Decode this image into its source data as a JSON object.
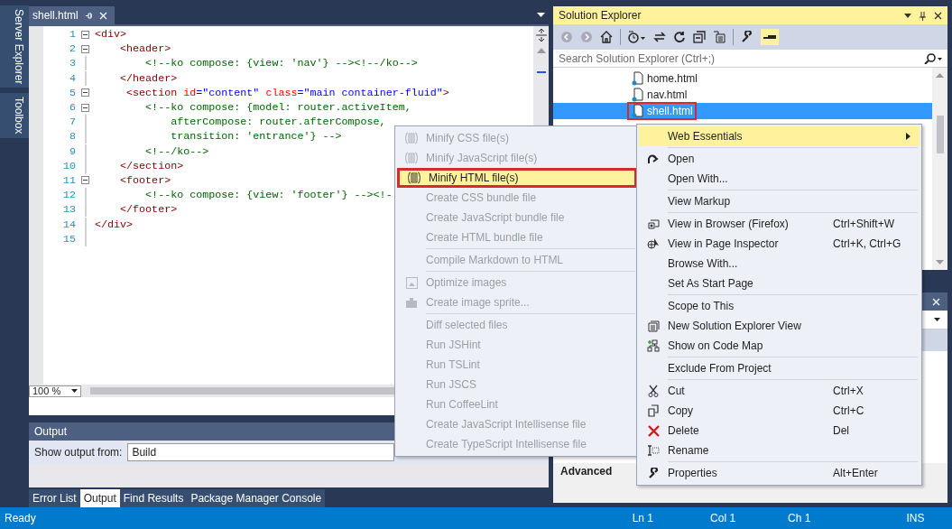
{
  "side_tabs": [
    "Server Explorer",
    "Toolbox"
  ],
  "editor": {
    "tab": {
      "label": "shell.html",
      "selected": true
    },
    "lines": [
      {
        "number": "1",
        "fold": true,
        "parts": [
          {
            "kind": "tag",
            "text": "<div>"
          }
        ]
      },
      {
        "number": "2",
        "fold": true,
        "parts": [
          {
            "kind": "tag",
            "text": "    <header>"
          }
        ]
      },
      {
        "number": "3",
        "fold": false,
        "parts": [
          {
            "kind": "comment",
            "text": "        <!--ko compose: {view: 'nav'} --><!--/ko-->"
          }
        ]
      },
      {
        "number": "4",
        "fold": false,
        "parts": [
          {
            "kind": "tag",
            "text": "    </header>"
          }
        ]
      },
      {
        "number": "5",
        "fold": true,
        "parts": [
          {
            "kind": "tag",
            "text": "     <section"
          },
          {
            "kind": "attr",
            "text": " id"
          },
          {
            "kind": "value",
            "text": "=\"content\""
          },
          {
            "kind": "attr",
            "text": " class"
          },
          {
            "kind": "value",
            "text": "=\"main container-fluid\""
          },
          {
            "kind": "tag",
            "text": ">"
          }
        ]
      },
      {
        "number": "6",
        "fold": true,
        "parts": [
          {
            "kind": "comment",
            "text": "        <!--ko compose: {model: router.activeItem,"
          }
        ]
      },
      {
        "number": "7",
        "fold": false,
        "parts": [
          {
            "kind": "comment",
            "text": "            afterCompose: router.afterCompose,"
          }
        ]
      },
      {
        "number": "8",
        "fold": false,
        "parts": [
          {
            "kind": "comment",
            "text": "            transition: 'entrance'} -->"
          }
        ]
      },
      {
        "number": "9",
        "fold": false,
        "parts": [
          {
            "kind": "comment",
            "text": "        <!--/ko-->"
          }
        ]
      },
      {
        "number": "10",
        "fold": false,
        "parts": [
          {
            "kind": "tag",
            "text": "    </section>"
          }
        ]
      },
      {
        "number": "11",
        "fold": true,
        "parts": [
          {
            "kind": "tag",
            "text": "    <footer>"
          }
        ]
      },
      {
        "number": "12",
        "fold": false,
        "parts": [
          {
            "kind": "comment",
            "text": "        <!--ko compose: {view: 'footer'} --><!-"
          }
        ]
      },
      {
        "number": "13",
        "fold": false,
        "parts": [
          {
            "kind": "tag",
            "text": "    </footer>"
          }
        ]
      },
      {
        "number": "14",
        "fold": false,
        "parts": [
          {
            "kind": "tag",
            "text": "</div>"
          }
        ]
      },
      {
        "number": "15",
        "fold": false
      }
    ],
    "zoom": "100 %"
  },
  "output": {
    "title": "Output",
    "show_from_label": "Show output from:",
    "source": "Build"
  },
  "bottom_tabs": [
    {
      "label": "Error List",
      "selected": false
    },
    {
      "label": "Output",
      "selected": true
    },
    {
      "label": "Find Results",
      "selected": false
    },
    {
      "label": "Package Manager Console",
      "selected": false
    }
  ],
  "solution_explorer": {
    "title": "Solution Explorer",
    "search": {
      "placeholder": "Search Solution Explorer (Ctrl+;)"
    },
    "items": [
      {
        "label": "home.html",
        "selected": false,
        "outlined": false
      },
      {
        "label": "nav.html",
        "selected": false,
        "outlined": false
      },
      {
        "label": "shell.html",
        "selected": true,
        "outlined": true
      }
    ]
  },
  "properties": {
    "section": "Advanced"
  },
  "context_menu": [
    {
      "kind": "item",
      "label": "Web Essentials",
      "highlighted": true,
      "submenu": true
    },
    {
      "kind": "separator"
    },
    {
      "kind": "item",
      "label": "Open",
      "highlighted": false
    },
    {
      "kind": "item",
      "label": "Open With...",
      "highlighted": false
    },
    {
      "kind": "separator"
    },
    {
      "kind": "item",
      "label": "View Markup",
      "highlighted": false
    },
    {
      "kind": "separator"
    },
    {
      "kind": "item",
      "label": "View in Browser (Firefox)",
      "shortcut": "Ctrl+Shift+W",
      "highlighted": false
    },
    {
      "kind": "item",
      "label": "View in Page Inspector",
      "shortcut": "Ctrl+K, Ctrl+G",
      "highlighted": false
    },
    {
      "kind": "item",
      "label": "Browse With...",
      "highlighted": false
    },
    {
      "kind": "item",
      "label": "Set As Start Page",
      "highlighted": false
    },
    {
      "kind": "separator"
    },
    {
      "kind": "item",
      "label": "Scope to This",
      "highlighted": false
    },
    {
      "kind": "item",
      "label": "New Solution Explorer View",
      "highlighted": false
    },
    {
      "kind": "item",
      "label": "Show on Code Map",
      "highlighted": false
    },
    {
      "kind": "separator"
    },
    {
      "kind": "item",
      "label": "Exclude From Project",
      "highlighted": false
    },
    {
      "kind": "separator"
    },
    {
      "kind": "item",
      "label": "Cut",
      "shortcut": "Ctrl+X",
      "highlighted": false
    },
    {
      "kind": "item",
      "label": "Copy",
      "shortcut": "Ctrl+C",
      "highlighted": false
    },
    {
      "kind": "item",
      "label": "Delete",
      "shortcut": "Del",
      "highlighted": false
    },
    {
      "kind": "item",
      "label": "Rename",
      "highlighted": false
    },
    {
      "kind": "separator"
    },
    {
      "kind": "item",
      "label": "Properties",
      "shortcut": "Alt+Enter",
      "highlighted": false
    }
  ],
  "submenu": [
    {
      "kind": "item",
      "label": "Minify CSS file(s)",
      "disabled": true,
      "highlighted": false,
      "outlined": false
    },
    {
      "kind": "item",
      "label": "Minify JavaScript file(s)",
      "disabled": true,
      "highlighted": false,
      "outlined": false
    },
    {
      "kind": "item",
      "label": "Minify HTML file(s)",
      "disabled": false,
      "highlighted": true,
      "outlined": true
    },
    {
      "kind": "item",
      "label": "Create CSS bundle file",
      "disabled": true,
      "highlighted": false,
      "outlined": false
    },
    {
      "kind": "item",
      "label": "Create JavaScript bundle file",
      "disabled": true,
      "highlighted": false,
      "outlined": false
    },
    {
      "kind": "item",
      "label": "Create HTML bundle file",
      "disabled": true,
      "highlighted": false,
      "outlined": false
    },
    {
      "kind": "separator"
    },
    {
      "kind": "item",
      "label": "Compile Markdown to HTML",
      "disabled": true,
      "highlighted": false,
      "outlined": false
    },
    {
      "kind": "separator"
    },
    {
      "kind": "item",
      "label": "Optimize images",
      "disabled": true,
      "highlighted": false,
      "outlined": false
    },
    {
      "kind": "item",
      "label": "Create image sprite...",
      "disabled": true,
      "highlighted": false,
      "outlined": false
    },
    {
      "kind": "separator"
    },
    {
      "kind": "item",
      "label": "Diff selected files",
      "disabled": true,
      "highlighted": false,
      "outlined": false
    },
    {
      "kind": "item",
      "label": "Run JSHint",
      "disabled": true,
      "highlighted": false,
      "outlined": false
    },
    {
      "kind": "item",
      "label": "Run TSLint",
      "disabled": true,
      "highlighted": false,
      "outlined": false
    },
    {
      "kind": "item",
      "label": "Run JSCS",
      "disabled": true,
      "highlighted": false,
      "outlined": false
    },
    {
      "kind": "item",
      "label": "Run CoffeeLint",
      "disabled": true,
      "highlighted": false,
      "outlined": false
    },
    {
      "kind": "item",
      "label": "Create JavaScript Intellisense file",
      "disabled": true,
      "highlighted": false,
      "outlined": false
    },
    {
      "kind": "item",
      "label": "Create TypeScript Intellisense file",
      "disabled": true,
      "highlighted": false,
      "outlined": false
    }
  ],
  "status_bar": {
    "message": "Ready",
    "line": "Ln 1",
    "column": "Col 1",
    "char": "Ch 1",
    "mode": "INS"
  }
}
